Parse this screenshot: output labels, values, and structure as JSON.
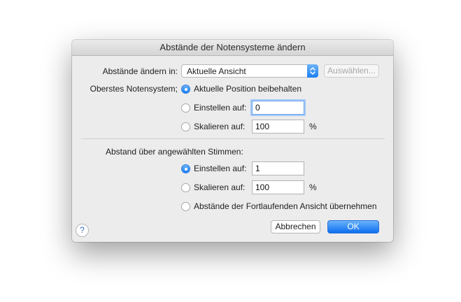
{
  "dialog": {
    "title": "Abstände der Notensysteme ändern"
  },
  "change_in": {
    "label": "Abstände ändern in:",
    "selected": "Aktuelle Ansicht",
    "select_button": "Auswählen..."
  },
  "top_staff": {
    "label": "Oberstes Notensystem;",
    "option_keep": "Aktuelle Position beibehalten",
    "option_set": "Einstellen auf:",
    "set_value": "0",
    "option_scale": "Skalieren auf:",
    "scale_value": "100",
    "percent": "%",
    "selected": "option_keep"
  },
  "spacing_selected": {
    "label": "Abstand über angewählten Stimmen:",
    "option_set": "Einstellen auf:",
    "set_value": "1",
    "option_scale": "Skalieren auf:",
    "scale_value": "100",
    "percent": "%",
    "option_inherit": "Abstände der Fortlaufenden Ansicht übernehmen",
    "selected": "option_set"
  },
  "buttons": {
    "help": "?",
    "cancel": "Abbrechen",
    "ok": "OK"
  },
  "colors": {
    "accent": "#1c7ff2",
    "dialog_bg": "#ececec"
  }
}
